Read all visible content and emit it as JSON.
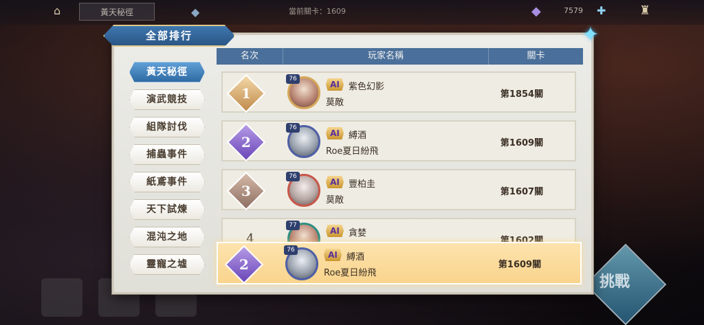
{
  "top_bar": {
    "mode_label": "黃天秘徑",
    "stage_text": "當前關卡：1609",
    "gem_count": "7579"
  },
  "panel": {
    "title": "全部排行",
    "close_icon": "close-star-icon"
  },
  "menu": {
    "items": [
      {
        "label": "黃天秘徑",
        "active": true
      },
      {
        "label": "演武競技",
        "active": false
      },
      {
        "label": "組隊討伐",
        "active": false
      },
      {
        "label": "捕蟲事件",
        "active": false
      },
      {
        "label": "紙鳶事件",
        "active": false
      },
      {
        "label": "天下試煉",
        "active": false
      },
      {
        "label": "混沌之地",
        "active": false
      },
      {
        "label": "靈寵之墟",
        "active": false
      }
    ]
  },
  "table": {
    "headers": {
      "rank": "名次",
      "player": "玩家名稱",
      "stage": "關卡"
    },
    "rows": [
      {
        "rank": "1",
        "level": "76",
        "ai": "AI",
        "name": "紫色幻影",
        "team": "莫敵",
        "stage": "第1854關"
      },
      {
        "rank": "2",
        "level": "76",
        "ai": "AI",
        "name": "縛酒",
        "team": "Roe夏日紛飛",
        "stage": "第1609關"
      },
      {
        "rank": "3",
        "level": "76",
        "ai": "AI",
        "name": "豐柏圭",
        "team": "莫敵",
        "stage": "第1607關"
      },
      {
        "rank": "4",
        "level": "77",
        "ai": "AI",
        "name": "貪婪",
        "team": "",
        "stage": "第1602關"
      }
    ],
    "self_row": {
      "rank": "2",
      "level": "76",
      "ai": "AI",
      "name": "縛酒",
      "team": "Roe夏日紛飛",
      "stage": "第1609關"
    }
  },
  "challenge_button": {
    "label": "挑戰"
  },
  "colors": {
    "accent_blue": "#2f6aa3",
    "highlight_gold": "#f9d48d"
  }
}
